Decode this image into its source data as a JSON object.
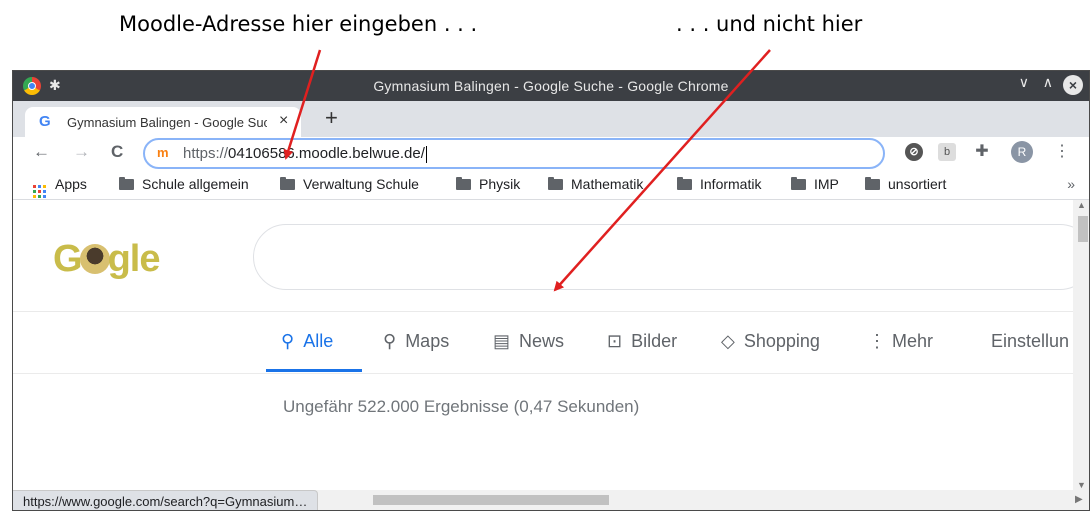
{
  "annotations": {
    "left": "Moodle-Adresse hier eingeben . . .",
    "right": ". . . und nicht hier",
    "arrow_color": "#e02020"
  },
  "window": {
    "title": "Gymnasium Balingen - Google Suche - Google Chrome",
    "titlebar_color": "#3c3f44"
  },
  "tab": {
    "title": "Gymnasium Balingen - Google Suche",
    "favicon": "G",
    "close": "×",
    "new_tab": "+"
  },
  "toolbar": {
    "back": "←",
    "forward": "→",
    "reload": "C",
    "site_icon": "m",
    "url_protocol": "https://",
    "url_host": "04106586.moodle.belwue.de/",
    "avatar_letter": "R",
    "ext_icon_1": "b",
    "menu": "⋮"
  },
  "bookmarks": {
    "apps": "Apps",
    "items": [
      "Schule allgemein",
      "Verwaltung Schule",
      "Physik",
      "Mathematik",
      "Informatik",
      "IMP",
      "unsortiert"
    ],
    "more": "»"
  },
  "google": {
    "logo": "Google",
    "tabs": [
      {
        "label": "Alle",
        "icon": "search-icon"
      },
      {
        "label": "Maps",
        "icon": "map-pin-icon"
      },
      {
        "label": "News",
        "icon": "news-icon"
      },
      {
        "label": "Bilder",
        "icon": "image-icon"
      },
      {
        "label": "Shopping",
        "icon": "tag-icon"
      },
      {
        "label": "Mehr",
        "icon": "more-vertical-icon"
      },
      {
        "label": "Einstellun",
        "icon": ""
      }
    ],
    "active_tab": "Alle",
    "accent": "#1a73e8",
    "result_stats": "Ungefähr 522.000 Ergebnisse (0,47 Sekunden)"
  },
  "status_bar": "https://www.google.com/search?q=Gymnasium…"
}
